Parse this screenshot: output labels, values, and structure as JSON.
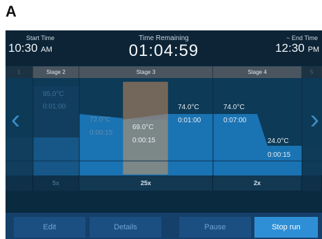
{
  "figure_label": "A",
  "header": {
    "start_caption": "Start Time",
    "start_time": "10:30",
    "start_ampm": "AM",
    "remaining_caption": "Time Remaining",
    "remaining_value": "01:04:59",
    "end_caption": "~ End Time",
    "end_time": "12:30",
    "end_ampm": "PM"
  },
  "tabs": [
    "1",
    "Stage 2",
    "Stage 3",
    "Stage 4",
    "5"
  ],
  "steps": [
    {
      "temp": "95.0°C",
      "time": "0:01:00"
    },
    {
      "temp": "72.0°C",
      "time": "0:00:15"
    },
    {
      "temp": "69.0°C",
      "time": "0:00:15"
    },
    {
      "temp": "74.0°C",
      "time": "0:01:00"
    },
    {
      "temp": "74.0°C",
      "time": "0:07:00"
    },
    {
      "temp": "24.0°C",
      "time": "0:00:15"
    }
  ],
  "cycles": [
    "5x",
    "25x",
    "2x"
  ],
  "buttons": {
    "edit": "Edit",
    "details": "Details",
    "pause": "Pause",
    "stop": "Stop run"
  },
  "colors": {
    "accent": "#2f8fd6",
    "active_step": "#c88a5e",
    "profile_fill": "#1a73b3"
  }
}
